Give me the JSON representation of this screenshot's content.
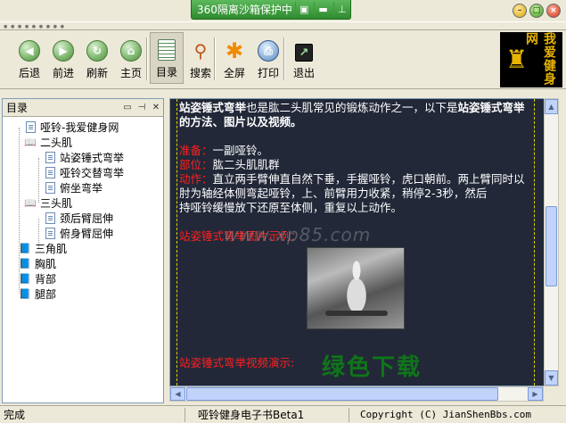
{
  "sandbox": {
    "label": "360隔离沙箱保护中..."
  },
  "toolbar": {
    "back": "后退",
    "forward": "前进",
    "refresh": "刷新",
    "home": "主页",
    "toc": "目录",
    "search": "搜索",
    "fullscreen": "全屏",
    "print": "打印",
    "exit": "退出"
  },
  "logo": {
    "text": "我爱健身网"
  },
  "sidebar": {
    "title": "目录",
    "items": [
      {
        "label": "哑铃-我爱健身网",
        "level": 1,
        "icon": "page"
      },
      {
        "label": "二头肌",
        "level": 1,
        "icon": "open-book"
      },
      {
        "label": "站姿锤式弯举",
        "level": 2,
        "icon": "page"
      },
      {
        "label": "哑铃交替弯举",
        "level": 2,
        "icon": "page"
      },
      {
        "label": "俯坐弯举",
        "level": 2,
        "icon": "page"
      },
      {
        "label": "三头肌",
        "level": 1,
        "icon": "open-book"
      },
      {
        "label": "颈后臂屈伸",
        "level": 2,
        "icon": "page"
      },
      {
        "label": "俯身臂屈伸",
        "level": 2,
        "icon": "page"
      },
      {
        "label": "三角肌",
        "level": 0,
        "icon": "closed-book"
      },
      {
        "label": "胸肌",
        "level": 0,
        "icon": "closed-book"
      },
      {
        "label": "背部",
        "level": 0,
        "icon": "closed-book"
      },
      {
        "label": "腿部",
        "level": 0,
        "icon": "closed-book"
      }
    ]
  },
  "content": {
    "intro_bold_1": "站姿锤式弯举",
    "intro_text": "也是肱二头肌常见的锻炼动作之一，以下是",
    "intro_bold_2": "站姿锤式弯举的方法、图片以及视频。",
    "prep_label": "准备：",
    "prep_text": "一副哑铃。",
    "part_label": "部位：",
    "part_text": "肱二头肌肌群",
    "action_label": "动作：",
    "action_text": "直立两手臂伸直自然下垂，手握哑铃，虎口朝前。两上臂同时以肘为轴经体侧弯起哑铃，上、前臂用力收紧，稍停2-3秒，然后",
    "action_text_2": "持哑铃缓慢放下还原至体侧，重复以上动作。",
    "pic_heading": "站姿锤式弯举图片示例：",
    "video_heading": "站姿锤式弯举视频演示:",
    "watermark": "绿色下载",
    "watermark2": "www.xp85.com"
  },
  "status": {
    "left": "完成",
    "middle": "哑铃健身电子书Beta1",
    "right": "Copyright (C) JianShenBbs.com"
  }
}
